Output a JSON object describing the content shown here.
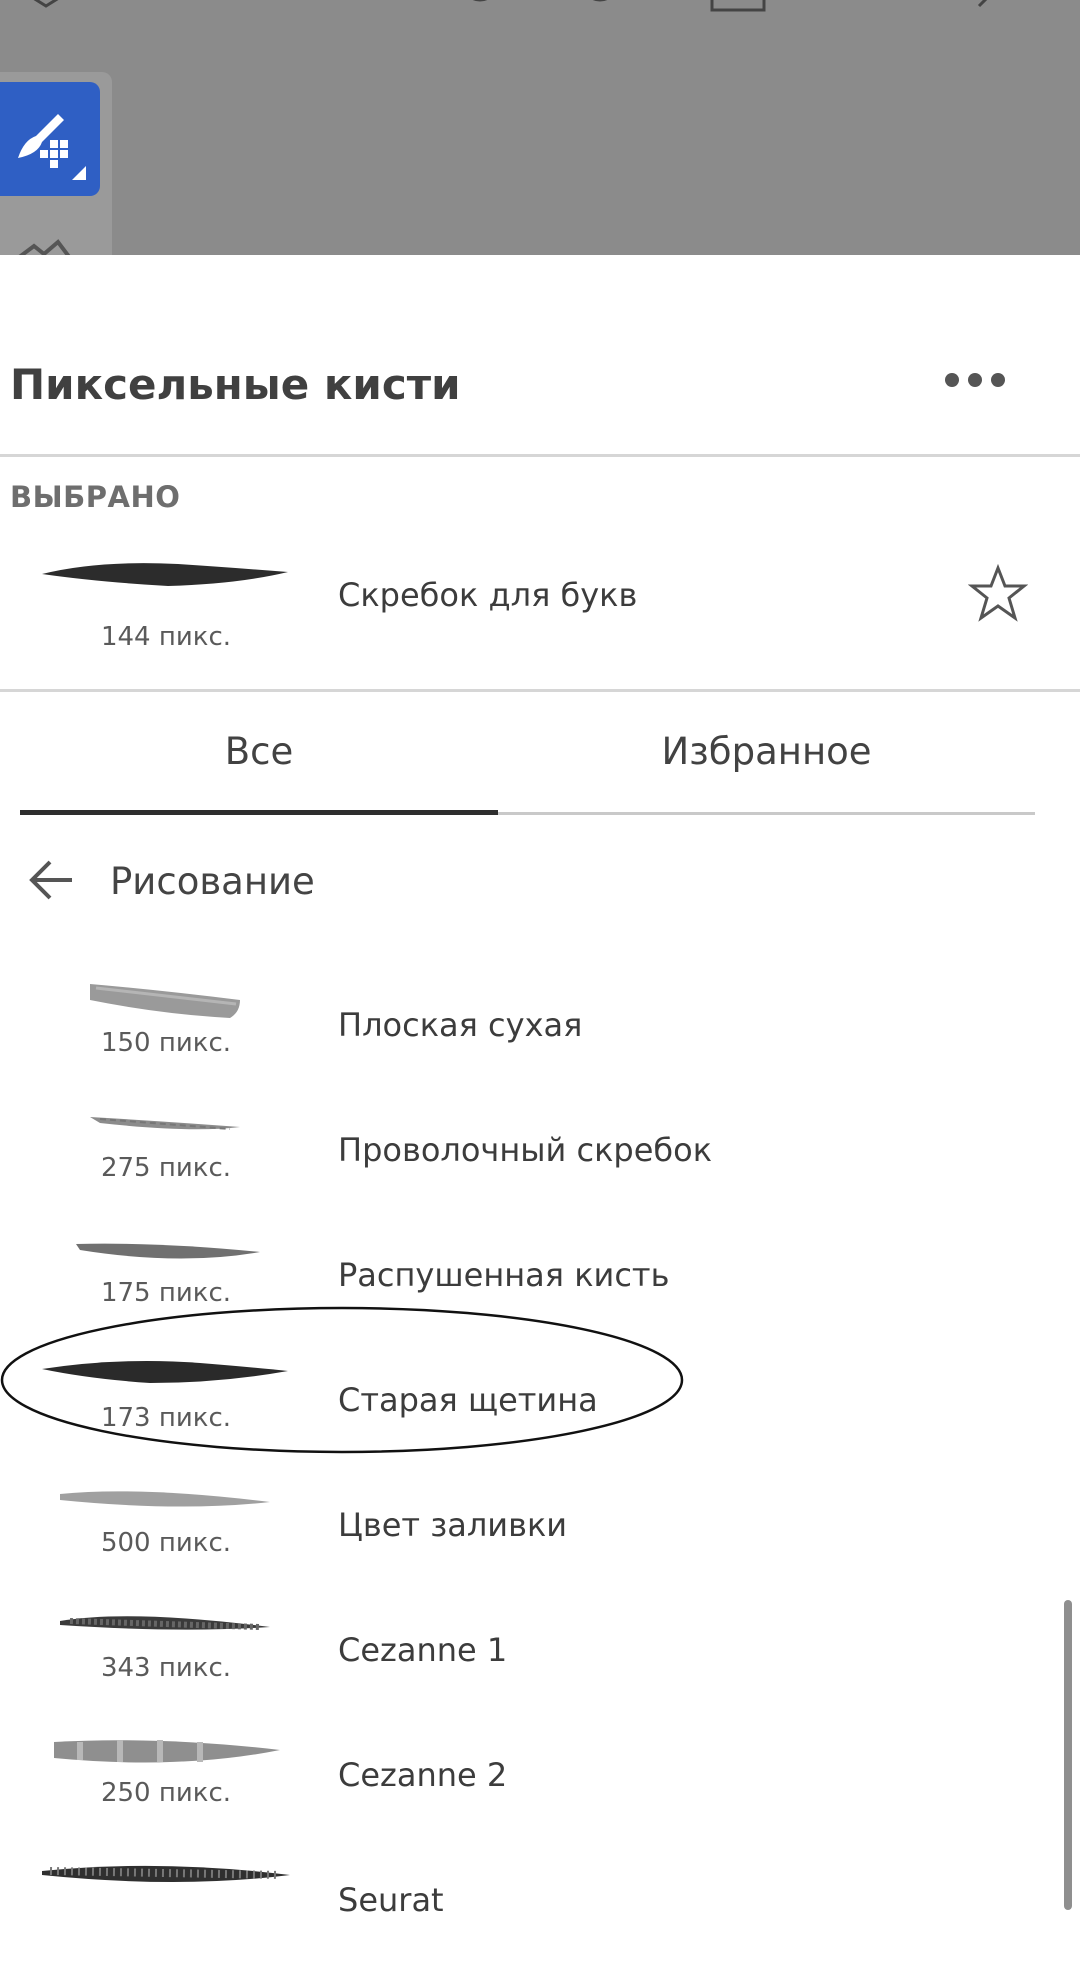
{
  "header": {
    "title": "Пиксельные кисти"
  },
  "selected": {
    "section_label": "ВЫБРАНО",
    "brush_name": "Скребок для букв",
    "size": "144 пикс."
  },
  "tabs": {
    "all": "Все",
    "favorites": "Избранное",
    "active": "all"
  },
  "category": {
    "title": "Рисование"
  },
  "brushes": [
    {
      "name": "Плоская сухая",
      "size": "150 пикс."
    },
    {
      "name": "Проволочный скребок",
      "size": "275 пикс."
    },
    {
      "name": "Распушенная кисть",
      "size": "175 пикс."
    },
    {
      "name": "Старая щетина",
      "size": "173 пикс."
    },
    {
      "name": "Цвет заливки",
      "size": "500 пикс."
    },
    {
      "name": "Cezanne 1",
      "size": "343 пикс."
    },
    {
      "name": "Cezanne 2",
      "size": "250 пикс."
    },
    {
      "name": "Seurat",
      "size": ""
    }
  ],
  "colors": {
    "accent": "#2f5fc4",
    "canvas_dim": "#8b8b8b",
    "tab_active": "#2e2e2e"
  },
  "icons": {
    "brush_tool": "paintbrush-grid-icon",
    "more": "more-horizontal-icon",
    "favorite": "star-outline-icon",
    "back": "arrow-left-icon"
  }
}
